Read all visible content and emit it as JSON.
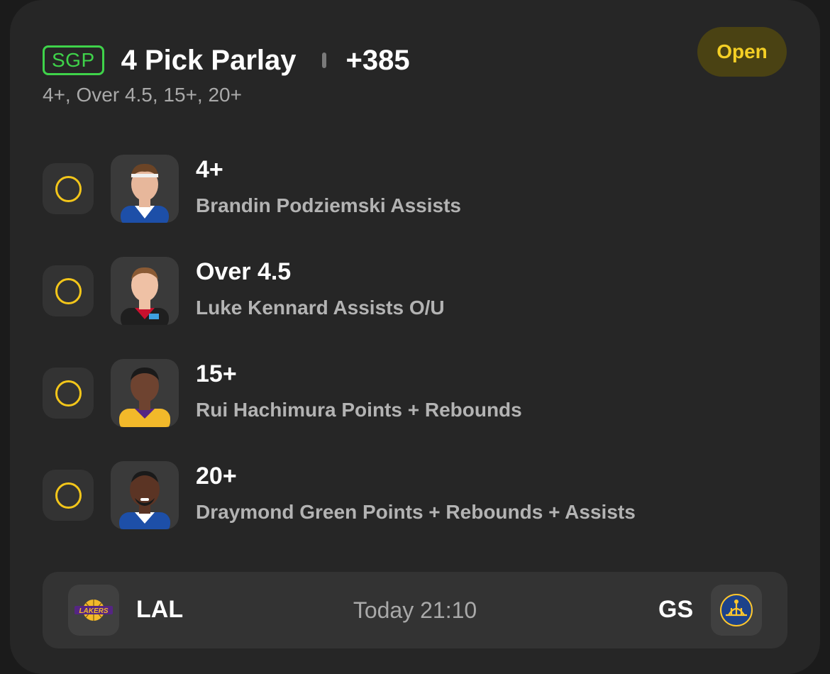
{
  "header": {
    "badge": "SGP",
    "title": "4 Pick Parlay",
    "odds": "+385",
    "subtitle": "4+, Over 4.5, 15+, 20+",
    "status": "Open"
  },
  "picks": [
    {
      "line": "4+",
      "desc": "Brandin Podziemski Assists",
      "jersey": "#1d4fa8",
      "skin": "#e7b79b",
      "hair": "#6b4426"
    },
    {
      "line": "Over 4.5",
      "desc": "Luke Kennard Assists O/U",
      "jersey": "#1f1f1f",
      "skin": "#efc1a5",
      "hair": "#8a5a34"
    },
    {
      "line": "15+",
      "desc": "Rui Hachimura Points + Rebounds",
      "jersey": "#f2b92a",
      "skin": "#6e4330",
      "hair": "#1a1a1a"
    },
    {
      "line": "20+",
      "desc": "Draymond Green Points + Rebounds + Assists",
      "jersey": "#1d4fa8",
      "skin": "#5b3424",
      "hair": "#1a1a1a"
    }
  ],
  "game": {
    "home_abbr": "LAL",
    "away_abbr": "GS",
    "time": "Today 21:10",
    "home_logo": "lakers-logo",
    "away_logo": "warriors-logo"
  },
  "colors": {
    "accent_green": "#3fd34a",
    "accent_yellow": "#f3c61a",
    "card_bg": "#262626"
  }
}
